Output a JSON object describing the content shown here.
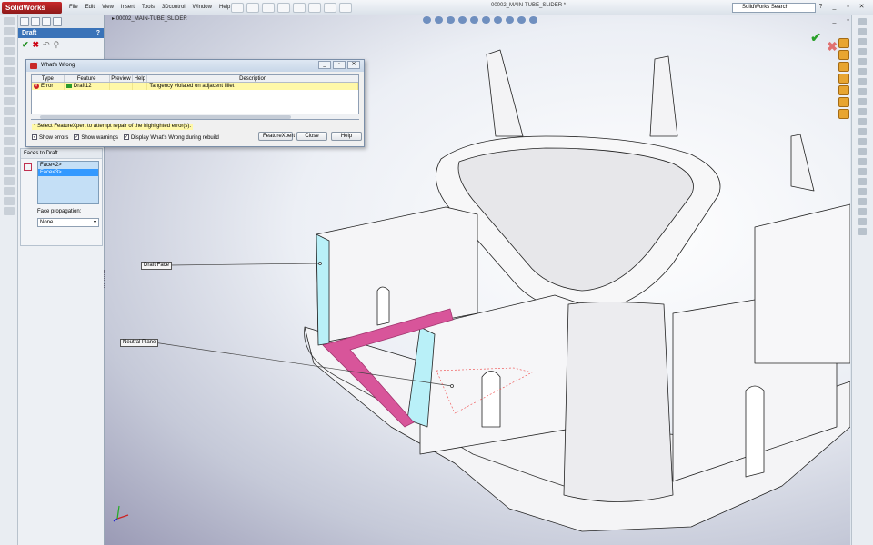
{
  "app": {
    "logo": "SolidWorks",
    "document_title": "00002_MAIN-TUBE_SLIDER *"
  },
  "menu": [
    "File",
    "Edit",
    "View",
    "Insert",
    "Tools",
    "3Dcontrol",
    "Window",
    "Help"
  ],
  "search": {
    "placeholder": "SolidWorks Search"
  },
  "window_controls": {
    "minimize": "_",
    "restore": "▫",
    "close": "✕"
  },
  "feature_tree": {
    "root": "00002_MAIN-TUBE_SLIDER"
  },
  "property_manager": {
    "title": "Draft",
    "help": "?",
    "ok": "✔",
    "cancel": "✖",
    "section_title": "Faces to Draft",
    "faces": [
      "Face<2>",
      "Face<3>"
    ],
    "selected_face": "Face<3>",
    "face_propagation_label": "Face propagation:",
    "face_propagation_value": "None"
  },
  "whats_wrong": {
    "title": "What's Wrong",
    "columns": [
      "Type",
      "Feature",
      "Preview",
      "Help",
      "Description"
    ],
    "row": {
      "type": "Error",
      "feature": "Draft12",
      "description": "Tangency violated on adjacent fillet"
    },
    "hint": "* Select FeatureXpert to attempt repair of the highlighted error(s).",
    "options": [
      {
        "label": "Show errors",
        "checked": true
      },
      {
        "label": "Show warnings",
        "checked": true
      },
      {
        "label": "Display What's Wrong during rebuild",
        "checked": true
      }
    ],
    "buttons": [
      "FeatureXpert",
      "Close",
      "Help"
    ]
  },
  "callouts": {
    "draft_face": "Draft Face",
    "neutral_plane": "Neutral Plane"
  },
  "colors": {
    "draft_face": "#b9f0f8",
    "neutral_plane": "#d8559a",
    "accent": "#3a73b8",
    "error_row": "#fff8a8"
  },
  "icons": [
    "solidworks-logo-icon",
    "search-icon",
    "error-icon",
    "draft-feature-icon",
    "triad-icon",
    "ok-check-icon",
    "cancel-x-icon"
  ]
}
